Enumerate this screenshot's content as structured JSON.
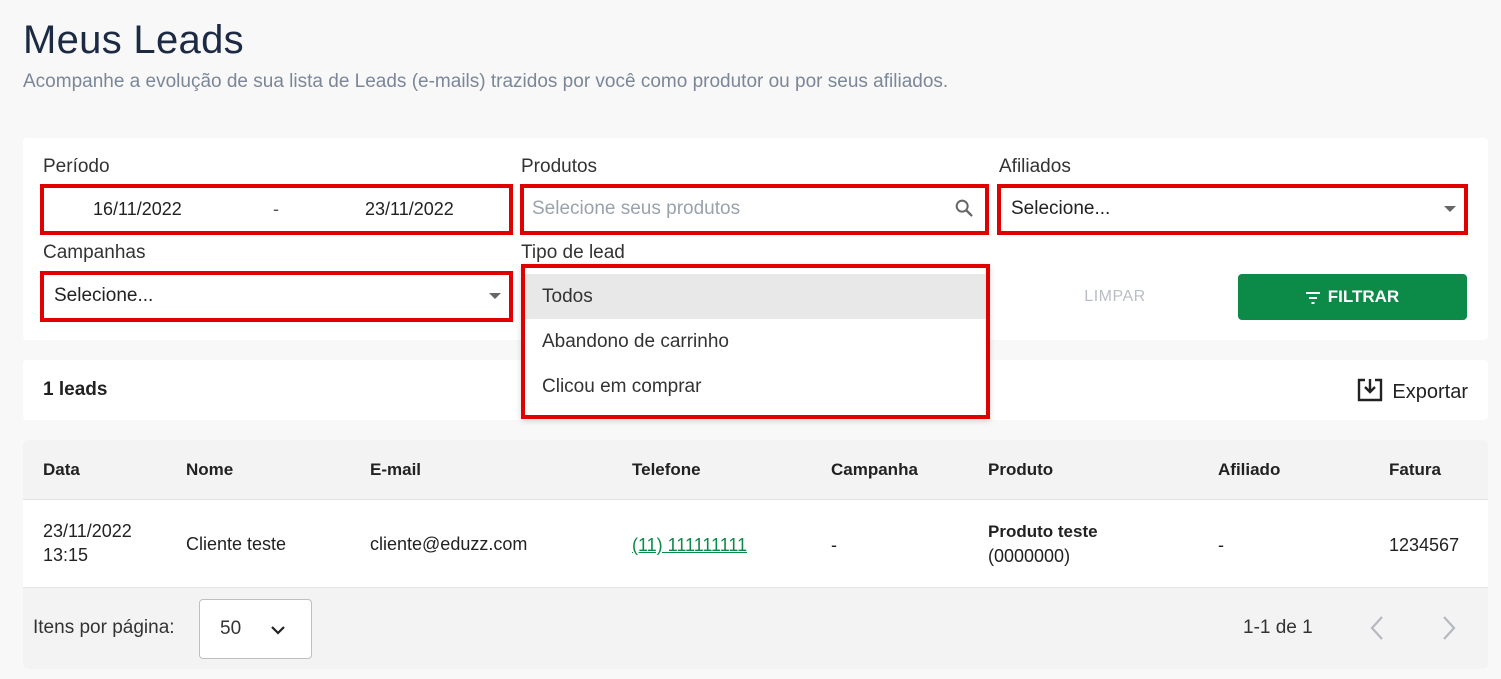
{
  "header": {
    "title": "Meus Leads",
    "subtitle": "Acompanhe a evolução de sua lista de Leads (e-mails) trazidos por você como produtor ou por seus afiliados."
  },
  "filters": {
    "periodo_label": "Período",
    "date_start": "16/11/2022",
    "date_separator": "-",
    "date_end": "23/11/2022",
    "produtos_label": "Produtos",
    "produtos_placeholder": "Selecione seus produtos",
    "afiliados_label": "Afiliados",
    "afiliados_value": "Selecione...",
    "campanhas_label": "Campanhas",
    "campanhas_value": "Selecione...",
    "tipo_lead_label": "Tipo de lead",
    "tipo_lead_options": [
      "Todos",
      "Abandono de carrinho",
      "Clicou em comprar"
    ],
    "limpar_label": "LIMPAR",
    "filtrar_label": "FILTRAR"
  },
  "summary": {
    "count": "1 leads",
    "export_label": "Exportar"
  },
  "table": {
    "columns": [
      "Data",
      "Nome",
      "E-mail",
      "Telefone",
      "Campanha",
      "Produto",
      "Afiliado",
      "Fatura"
    ],
    "rows": [
      {
        "date": "23/11/2022",
        "time": "13:15",
        "nome": "Cliente teste",
        "email": "cliente@eduzz.com",
        "telefone": "(11) 111111111",
        "campanha": "-",
        "produto_nome": "Produto teste",
        "produto_id": "(0000000)",
        "afiliado": "-",
        "fatura": "1234567"
      }
    ]
  },
  "pagination": {
    "per_page_label": "Itens por página:",
    "per_page_value": "50",
    "range": "1-1 de 1"
  },
  "colors": {
    "accent_green": "#0b8a48",
    "highlight_red": "#e00000",
    "title_navy": "#1c2a44"
  }
}
